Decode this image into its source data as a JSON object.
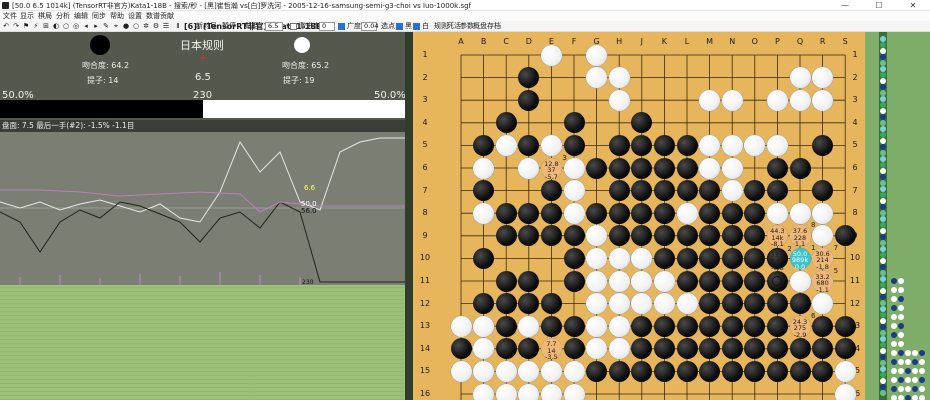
{
  "window": {
    "title": "[50.0 6.5 1014k] (TensorRT非官方)Kata1-18B - 搜索/秒 - [黑]崔哲瀚 vs[白]罗洗河 - 2005-12-16-samsung-semi-g3-choi vs luo-1000k.sgf",
    "minimize": "—",
    "maximize": "☐",
    "close": "✕"
  },
  "menu": [
    "文件",
    "显示",
    "棋局",
    "分析",
    "编辑",
    "同步",
    "帮助",
    "设置",
    "数谱贡献"
  ],
  "toolbar": {
    "engine_label": "[6]: (TensorRT非官方)Kata1-18B",
    "new_game": "新对局",
    "pause": "暂停",
    "komi_label": "贴目",
    "komi_value": "6.5",
    "komi_ok": "确定",
    "extend_label": "激进度",
    "extend_value": "0",
    "wide_label": "广度",
    "wide_value": "0.04",
    "select_label": "选点",
    "black_label": "黑",
    "white_label": "白",
    "rules": "规则",
    "deadstones": "死活",
    "params": "参数",
    "overview": "概盘",
    "save": "存档",
    "icons": [
      "undo-icon",
      "redo-icon",
      "flag-icon",
      "pass-icon",
      "analyze-icon",
      "circle-icon",
      "estimate-icon",
      "pause-icon",
      "arrow-left-icon",
      "arrow-right-icon",
      "edit-icon",
      "star-icon",
      "first-icon",
      "prev-icon",
      "next-icon",
      "last-icon",
      "close-icon"
    ]
  },
  "info": {
    "rule": "日本规则",
    "black_match": "吻合度: 64.2",
    "black_captures": "提子: 14",
    "white_match": "吻合度: 65.2",
    "white_captures": "提子: 19",
    "komi": "6.5",
    "winrate_left": "50.0%",
    "move_number": "230",
    "winrate_right": "50.0%",
    "black_winrate_fraction": 0.5
  },
  "status": "盘面: 7.5 最后一手(#2): -1.5% -1.1目",
  "graph_labels": {
    "a": "6.6",
    "b": "50.0",
    "c": "56.0",
    "d": "230"
  },
  "colors": {
    "board": "#e7b55c",
    "panel": "#55584c",
    "graph": "#7a7d70",
    "tatami": "#9cc27a",
    "teal": "#3cc3cc"
  },
  "board": {
    "columns": [
      "A",
      "B",
      "C",
      "D",
      "E",
      "F",
      "G",
      "H",
      "J",
      "K",
      "L",
      "M",
      "N",
      "O",
      "P",
      "Q",
      "R",
      "S"
    ],
    "rows": [
      "1",
      "2",
      "3",
      "4",
      "5",
      "6",
      "7",
      "8",
      "9",
      "10",
      "11",
      "12",
      "13",
      "14",
      "15",
      "16"
    ],
    "black": [
      [
        3,
        1
      ],
      [
        3,
        2
      ],
      [
        2,
        3
      ],
      [
        5,
        3
      ],
      [
        8,
        3
      ],
      [
        1,
        4
      ],
      [
        3,
        4
      ],
      [
        5,
        4
      ],
      [
        7,
        4
      ],
      [
        8,
        4
      ],
      [
        9,
        4
      ],
      [
        10,
        4
      ],
      [
        16,
        4
      ],
      [
        4,
        5
      ],
      [
        6,
        5
      ],
      [
        7,
        5
      ],
      [
        8,
        5
      ],
      [
        9,
        5
      ],
      [
        10,
        5
      ],
      [
        14,
        5
      ],
      [
        15,
        5
      ],
      [
        1,
        6
      ],
      [
        4,
        6
      ],
      [
        7,
        6
      ],
      [
        8,
        6
      ],
      [
        9,
        6
      ],
      [
        10,
        6
      ],
      [
        11,
        6
      ],
      [
        13,
        6
      ],
      [
        14,
        6
      ],
      [
        16,
        6
      ],
      [
        2,
        7
      ],
      [
        3,
        7
      ],
      [
        4,
        7
      ],
      [
        6,
        7
      ],
      [
        7,
        7
      ],
      [
        8,
        7
      ],
      [
        9,
        7
      ],
      [
        11,
        7
      ],
      [
        12,
        7
      ],
      [
        13,
        7
      ],
      [
        2,
        8
      ],
      [
        3,
        8
      ],
      [
        4,
        8
      ],
      [
        5,
        8
      ],
      [
        7,
        8
      ],
      [
        8,
        8
      ],
      [
        9,
        8
      ],
      [
        10,
        8
      ],
      [
        11,
        8
      ],
      [
        12,
        8
      ],
      [
        13,
        8
      ],
      [
        14,
        8
      ],
      [
        17,
        8
      ],
      [
        1,
        9
      ],
      [
        5,
        9
      ],
      [
        9,
        9
      ],
      [
        10,
        9
      ],
      [
        11,
        9
      ],
      [
        12,
        9
      ],
      [
        13,
        9
      ],
      [
        14,
        9
      ],
      [
        15,
        9
      ],
      [
        2,
        10
      ],
      [
        3,
        10
      ],
      [
        5,
        10
      ],
      [
        10,
        10
      ],
      [
        11,
        10
      ],
      [
        12,
        10
      ],
      [
        13,
        10
      ],
      [
        14,
        10
      ],
      [
        1,
        11
      ],
      [
        2,
        11
      ],
      [
        3,
        11
      ],
      [
        4,
        11
      ],
      [
        11,
        11
      ],
      [
        12,
        11
      ],
      [
        13,
        11
      ],
      [
        14,
        11
      ],
      [
        15,
        11
      ],
      [
        2,
        12
      ],
      [
        4,
        12
      ],
      [
        5,
        12
      ],
      [
        8,
        12
      ],
      [
        9,
        12
      ],
      [
        10,
        12
      ],
      [
        11,
        12
      ],
      [
        12,
        12
      ],
      [
        13,
        12
      ],
      [
        14,
        12
      ],
      [
        15,
        12
      ],
      [
        16,
        12
      ],
      [
        17,
        12
      ],
      [
        0,
        13
      ],
      [
        2,
        13
      ],
      [
        3,
        13
      ],
      [
        4,
        13
      ],
      [
        5,
        13
      ],
      [
        8,
        13
      ],
      [
        9,
        13
      ],
      [
        10,
        13
      ],
      [
        11,
        13
      ],
      [
        12,
        13
      ],
      [
        13,
        13
      ],
      [
        14,
        13
      ],
      [
        15,
        13
      ],
      [
        16,
        13
      ],
      [
        17,
        13
      ],
      [
        6,
        14
      ],
      [
        7,
        14
      ],
      [
        8,
        14
      ],
      [
        9,
        14
      ],
      [
        10,
        14
      ],
      [
        11,
        14
      ],
      [
        12,
        14
      ],
      [
        13,
        14
      ],
      [
        14,
        14
      ],
      [
        15,
        14
      ],
      [
        16,
        14
      ]
    ],
    "white": [
      [
        4,
        0
      ],
      [
        6,
        0
      ],
      [
        6,
        1
      ],
      [
        7,
        1
      ],
      [
        15,
        1
      ],
      [
        16,
        1
      ],
      [
        7,
        2
      ],
      [
        11,
        2
      ],
      [
        12,
        2
      ],
      [
        14,
        2
      ],
      [
        15,
        2
      ],
      [
        16,
        2
      ],
      [
        2,
        4
      ],
      [
        4,
        4
      ],
      [
        5,
        4
      ],
      [
        11,
        4
      ],
      [
        12,
        4
      ],
      [
        13,
        4
      ],
      [
        14,
        4
      ],
      [
        1,
        5
      ],
      [
        3,
        5
      ],
      [
        5,
        5
      ],
      [
        11,
        5
      ],
      [
        12,
        5
      ],
      [
        1,
        6
      ],
      [
        5,
        6
      ],
      [
        12,
        6
      ],
      [
        13,
        6
      ],
      [
        1,
        7
      ],
      [
        5,
        7
      ],
      [
        10,
        7
      ],
      [
        11,
        7
      ],
      [
        12,
        7
      ],
      [
        13,
        7
      ],
      [
        14,
        7
      ],
      [
        15,
        7
      ],
      [
        16,
        7
      ],
      [
        6,
        8
      ],
      [
        8,
        8
      ],
      [
        10,
        8
      ],
      [
        11,
        8
      ],
      [
        12,
        8
      ],
      [
        13,
        8
      ],
      [
        14,
        8
      ],
      [
        15,
        8
      ],
      [
        16,
        8
      ],
      [
        6,
        9
      ],
      [
        7,
        9
      ],
      [
        8,
        9
      ],
      [
        9,
        9
      ],
      [
        15,
        9
      ],
      [
        16,
        9
      ],
      [
        5,
        10
      ],
      [
        6,
        10
      ],
      [
        7,
        10
      ],
      [
        8,
        10
      ],
      [
        9,
        10
      ],
      [
        15,
        10
      ],
      [
        16,
        10
      ],
      [
        6,
        11
      ],
      [
        7,
        11
      ],
      [
        8,
        11
      ],
      [
        9,
        11
      ],
      [
        10,
        11
      ],
      [
        16,
        11
      ],
      [
        0,
        12
      ],
      [
        1,
        12
      ],
      [
        3,
        12
      ],
      [
        6,
        12
      ],
      [
        7,
        12
      ],
      [
        0,
        13
      ],
      [
        1,
        13
      ],
      [
        2,
        13
      ],
      [
        6,
        13
      ],
      [
        7,
        13
      ],
      [
        0,
        14
      ],
      [
        1,
        14
      ],
      [
        2,
        14
      ],
      [
        3,
        14
      ],
      [
        4,
        14
      ],
      [
        5,
        14
      ],
      [
        17,
        14
      ],
      [
        1,
        15
      ],
      [
        2,
        15
      ],
      [
        3,
        15
      ],
      [
        4,
        15
      ],
      [
        5,
        15
      ],
      [
        17,
        15
      ]
    ],
    "candidates": [
      {
        "col": 4,
        "row": 5,
        "lines": [
          "12.8",
          "37",
          "-5.7"
        ],
        "sup": "3",
        "style": "peach"
      },
      {
        "col": 15,
        "row": 8,
        "lines": [
          "37.6",
          "228",
          "1.1"
        ],
        "sup": "8",
        "style": "peach"
      },
      {
        "col": 14,
        "row": 8,
        "lines": [
          "44.3",
          "14k",
          "-8.1"
        ],
        "sup": "",
        "style": "peach"
      },
      {
        "col": 15,
        "row": 9,
        "lines": [
          "50.0",
          "989k",
          "0.0"
        ],
        "sup": "1",
        "style": "teal"
      },
      {
        "col": 14,
        "row": 9,
        "lines": [
          "33.2",
          "8.6k",
          "-0.8"
        ],
        "sup": "2",
        "style": "ring2"
      },
      {
        "col": 16,
        "row": 9,
        "lines": [
          "30.6",
          "214",
          "-1.8"
        ],
        "sup": "7",
        "style": "peach"
      },
      {
        "col": 16,
        "row": 10,
        "lines": [
          "33.2",
          "680",
          "-1.1"
        ],
        "sup": "5",
        "style": "peach"
      },
      {
        "col": 15,
        "row": 12,
        "lines": [
          "24.3",
          "275",
          "-2.9"
        ],
        "sup": "6",
        "style": "peach"
      },
      {
        "col": 4,
        "row": 13,
        "lines": [
          "7.7",
          "14",
          "-3.5"
        ],
        "sup": "",
        "style": "peach"
      }
    ],
    "last_move": [
      14,
      10
    ]
  }
}
